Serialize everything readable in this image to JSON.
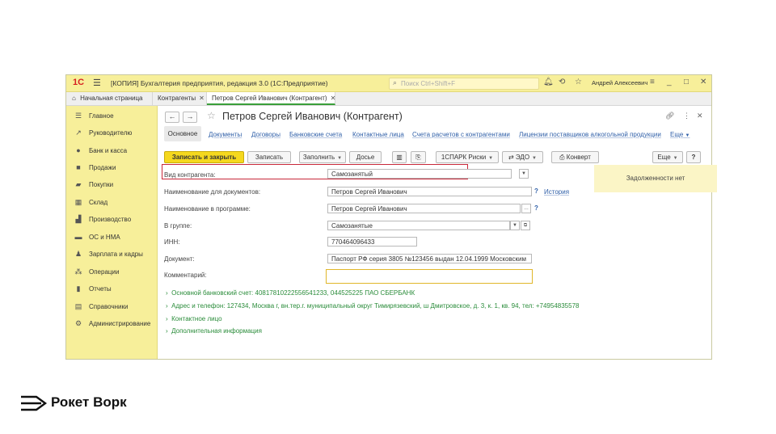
{
  "titlebar": {
    "logo": "1С",
    "title": "[КОПИЯ] Бухгалтерия предприятия, редакция 3.0  (1С:Предприятие)",
    "search_placeholder": "Поиск Ctrl+Shift+F",
    "user": "Андрей Алексеевич"
  },
  "tabs": [
    {
      "label": "Начальная страница"
    },
    {
      "label": "Контрагенты"
    },
    {
      "label": "Петров Сергей Иванович (Контрагент)"
    }
  ],
  "sidebar": {
    "items": [
      {
        "label": "Главное",
        "icon": "menu-icon"
      },
      {
        "label": "Руководителю",
        "icon": "chart-trend-icon"
      },
      {
        "label": "Банк и касса",
        "icon": "coin-icon"
      },
      {
        "label": "Продажи",
        "icon": "bag-icon"
      },
      {
        "label": "Покупки",
        "icon": "cart-icon"
      },
      {
        "label": "Склад",
        "icon": "warehouse-icon"
      },
      {
        "label": "Производство",
        "icon": "factory-icon"
      },
      {
        "label": "ОС и НМА",
        "icon": "truck-icon"
      },
      {
        "label": "Зарплата и кадры",
        "icon": "person-icon"
      },
      {
        "label": "Операции",
        "icon": "operations-icon"
      },
      {
        "label": "Отчеты",
        "icon": "bar-chart-icon"
      },
      {
        "label": "Справочники",
        "icon": "book-icon"
      },
      {
        "label": "Администрирование",
        "icon": "gear-icon"
      }
    ]
  },
  "doc": {
    "title": "Петров Сергей Иванович (Контрагент)"
  },
  "subtabs": {
    "active": "Основное",
    "links": [
      "Документы",
      "Договоры",
      "Банковские счета",
      "Контактные лица",
      "Счета расчетов с контрагентами",
      "Лицензии поставщиков алкогольной продукции",
      "Еще"
    ]
  },
  "toolbar": {
    "save_close": "Записать и закрыть",
    "save": "Записать",
    "fill": "Заполнить",
    "dossier": "Досье",
    "spark": "1СПАРК Риски",
    "edo": "ЭДО",
    "envelope": "Конверт",
    "more": "Еще",
    "help": "?"
  },
  "form": {
    "kind_label": "Вид контрагента:",
    "kind_value": "Самозанятый",
    "docname_label": "Наименование для документов:",
    "docname_value": "Петров Сергей Иванович",
    "history_link": "История",
    "progname_label": "Наименование в программе:",
    "progname_value": "Петров Сергей Иванович",
    "group_label": "В группе:",
    "group_value": "Самозанятые",
    "inn_label": "ИНН:",
    "inn_value": "770464096433",
    "document_label": "Документ:",
    "document_value": "Паспорт РФ серия 3805 №123456 выдан 12.04.1999 Московским",
    "comment_label": "Комментарий:",
    "comment_value": ""
  },
  "debt_panel": "Задолженности нет",
  "sections": [
    "Основной банковский счет: 40817810222556541233, 044525225 ПАО СБЕРБАНК",
    "Адрес и телефон: 127434, Москва г, вн.тер.г. муниципальный округ Тимирязевский, ш Дмитровское, д. 3, к. 1, кв. 94, тел: +74954835578",
    "Контактное лицо",
    "Дополнительная информация"
  ],
  "brand": {
    "name": "Рокет Ворк"
  },
  "colors": {
    "panel_yellow": "#f7ef9a",
    "primary_button": "#f5d81e",
    "link_blue": "#2f5fa8",
    "section_green": "#2a8c3a",
    "highlight_red": "#c8283a"
  }
}
